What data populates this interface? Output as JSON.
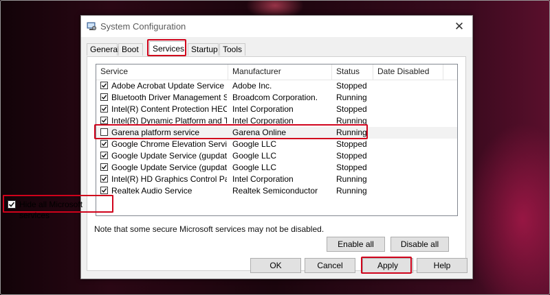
{
  "window": {
    "title": "System Configuration",
    "close_glyph": "✕"
  },
  "tabs": [
    {
      "label": "General"
    },
    {
      "label": "Boot"
    },
    {
      "label": "Services",
      "active": true
    },
    {
      "label": "Startup"
    },
    {
      "label": "Tools"
    }
  ],
  "columns": [
    "Service",
    "Manufacturer",
    "Status",
    "Date Disabled"
  ],
  "services": [
    {
      "name": "Adobe Acrobat Update Service",
      "manufacturer": "Adobe Inc.",
      "status": "Stopped",
      "checked": true
    },
    {
      "name": "Bluetooth Driver Management S...",
      "manufacturer": "Broadcom Corporation.",
      "status": "Running",
      "checked": true
    },
    {
      "name": "Intel(R) Content Protection HEC...",
      "manufacturer": "Intel Corporation",
      "status": "Stopped",
      "checked": true
    },
    {
      "name": "Intel(R) Dynamic Platform and T...",
      "manufacturer": "Intel Corporation",
      "status": "Running",
      "checked": true
    },
    {
      "name": "Garena platform service",
      "manufacturer": "Garena Online",
      "status": "Running",
      "checked": false,
      "selected": true
    },
    {
      "name": "Google Chrome Elevation Servic...",
      "manufacturer": "Google LLC",
      "status": "Stopped",
      "checked": true
    },
    {
      "name": "Google Update Service (gupdate)",
      "manufacturer": "Google LLC",
      "status": "Stopped",
      "checked": true
    },
    {
      "name": "Google Update Service (gupdatem)",
      "manufacturer": "Google LLC",
      "status": "Stopped",
      "checked": true
    },
    {
      "name": "Intel(R) HD Graphics Control Pa...",
      "manufacturer": "Intel Corporation",
      "status": "Running",
      "checked": true
    },
    {
      "name": "Realtek Audio Service",
      "manufacturer": "Realtek Semiconductor",
      "status": "Running",
      "checked": true
    }
  ],
  "note": "Note that some secure Microsoft services may not be disabled.",
  "buttons": {
    "enable_all": "Enable all",
    "disable_all": "Disable all",
    "ok": "OK",
    "cancel": "Cancel",
    "apply": "Apply",
    "help": "Help"
  },
  "hide_ms": {
    "label": "Hide all Microsoft services",
    "checked": true
  },
  "colors": {
    "highlight": "#d0021b",
    "window_bg": "#f0f0f0"
  }
}
